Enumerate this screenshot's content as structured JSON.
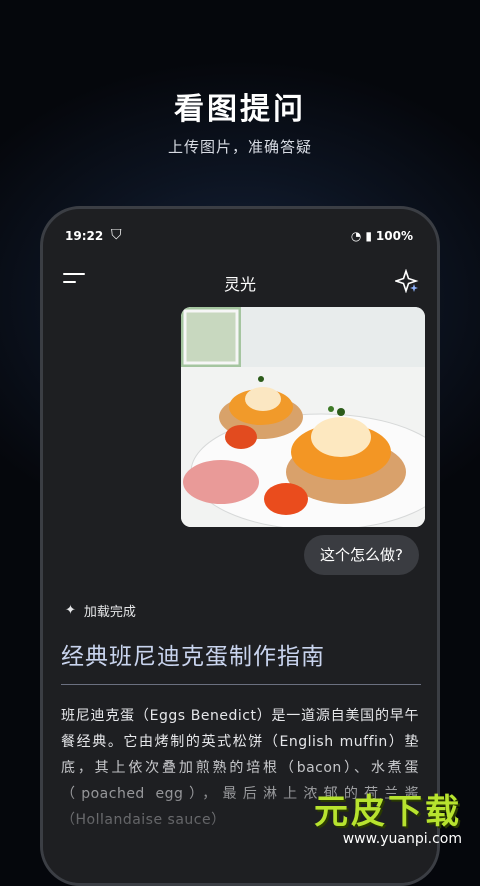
{
  "promo": {
    "title": "看图提问",
    "subtitle": "上传图片，准确答疑"
  },
  "status_bar": {
    "time": "19:22",
    "battery": "100%"
  },
  "app_bar": {
    "title": "灵光"
  },
  "chat": {
    "user_question": "这个怎么做?",
    "ai_status": "加载完成",
    "answer_title": "经典班尼迪克蛋制作指南",
    "answer_body": "班尼迪克蛋（Eggs Benedict）是一道源自美国的早午餐经典。它由烤制的英式松饼（English muffin）垫底，其上依次叠加煎熟的培根（bacon）、水煮蛋（poached egg），最后淋上浓郁的荷兰酱（Hollandaise sauce）"
  },
  "watermark": {
    "logo": "元皮下载",
    "url": "www.yuanpi.com"
  }
}
